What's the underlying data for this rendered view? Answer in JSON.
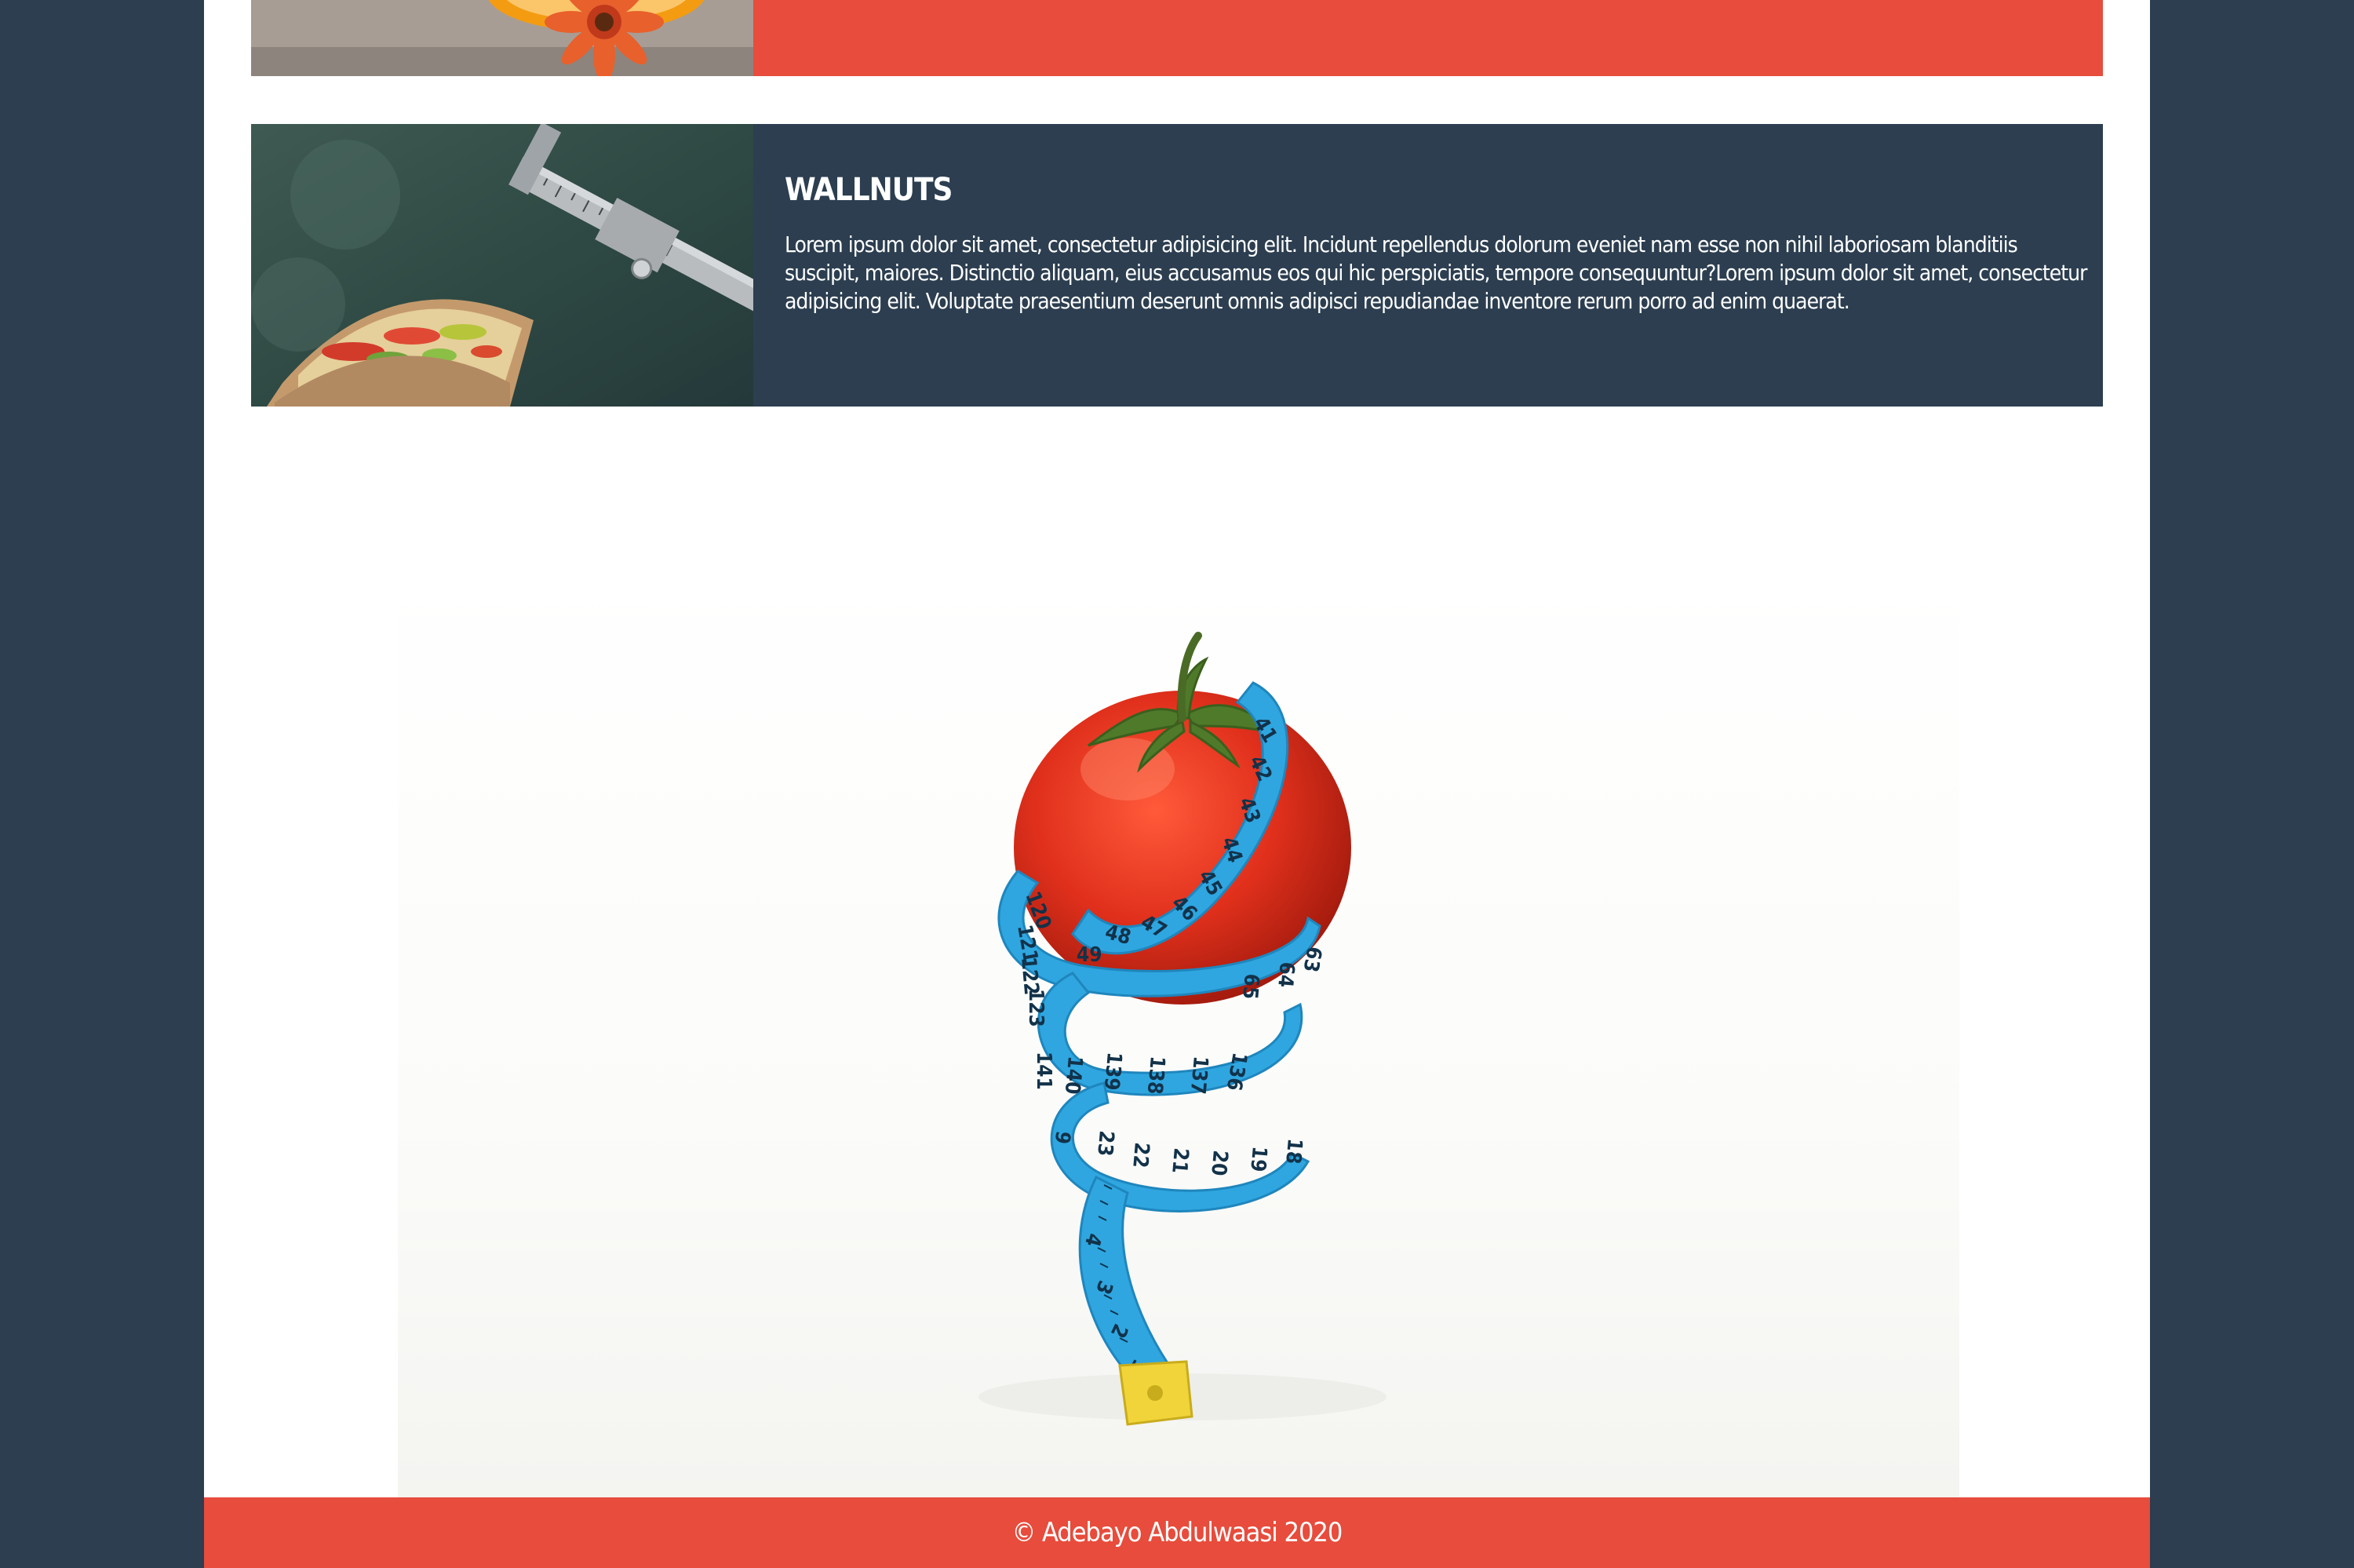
{
  "cards": [
    {
      "title": "",
      "text": "",
      "image_icon": "orange-flower-image",
      "accent": "#e74c3c"
    },
    {
      "title": "WALLNUTS",
      "text": "Lorem ipsum dolor sit amet, consectetur adipisicing elit. Incidunt repellendus dolorum eveniet nam esse non nihil laboriosam blanditiis suscipit, maiores. Distinctio aliquam, eius accusamus eos qui hic perspiciatis, tempore consequuntur?Lorem ipsum dolor sit amet, consectetur adipisicing elit. Voluptate praesentium deserunt omnis adipisci repudiandae inventore rerum porro ad enim quaerat.",
      "image_icon": "sandwich-caliper-image",
      "accent": "#2c3e50"
    }
  ],
  "hero": {
    "image_icon": "tomato-measuring-tape-image",
    "tape_numbers": [
      "41",
      "42",
      "43",
      "44",
      "45",
      "46",
      "47",
      "48",
      "49",
      "120",
      "121",
      "122",
      "123",
      "139",
      "138",
      "137",
      "136",
      "65",
      "64",
      "63",
      "140",
      "141",
      "23",
      "22",
      "21",
      "20",
      "19",
      "18",
      "9",
      "4",
      "3",
      "2",
      "1"
    ]
  },
  "footer": {
    "text": "© Adebayo Abdulwaasi 2020"
  },
  "colors": {
    "page_background": "#2c3e50",
    "container_background": "#ffffff",
    "red_accent": "#e74c3c",
    "navy_accent": "#2c3e50"
  }
}
